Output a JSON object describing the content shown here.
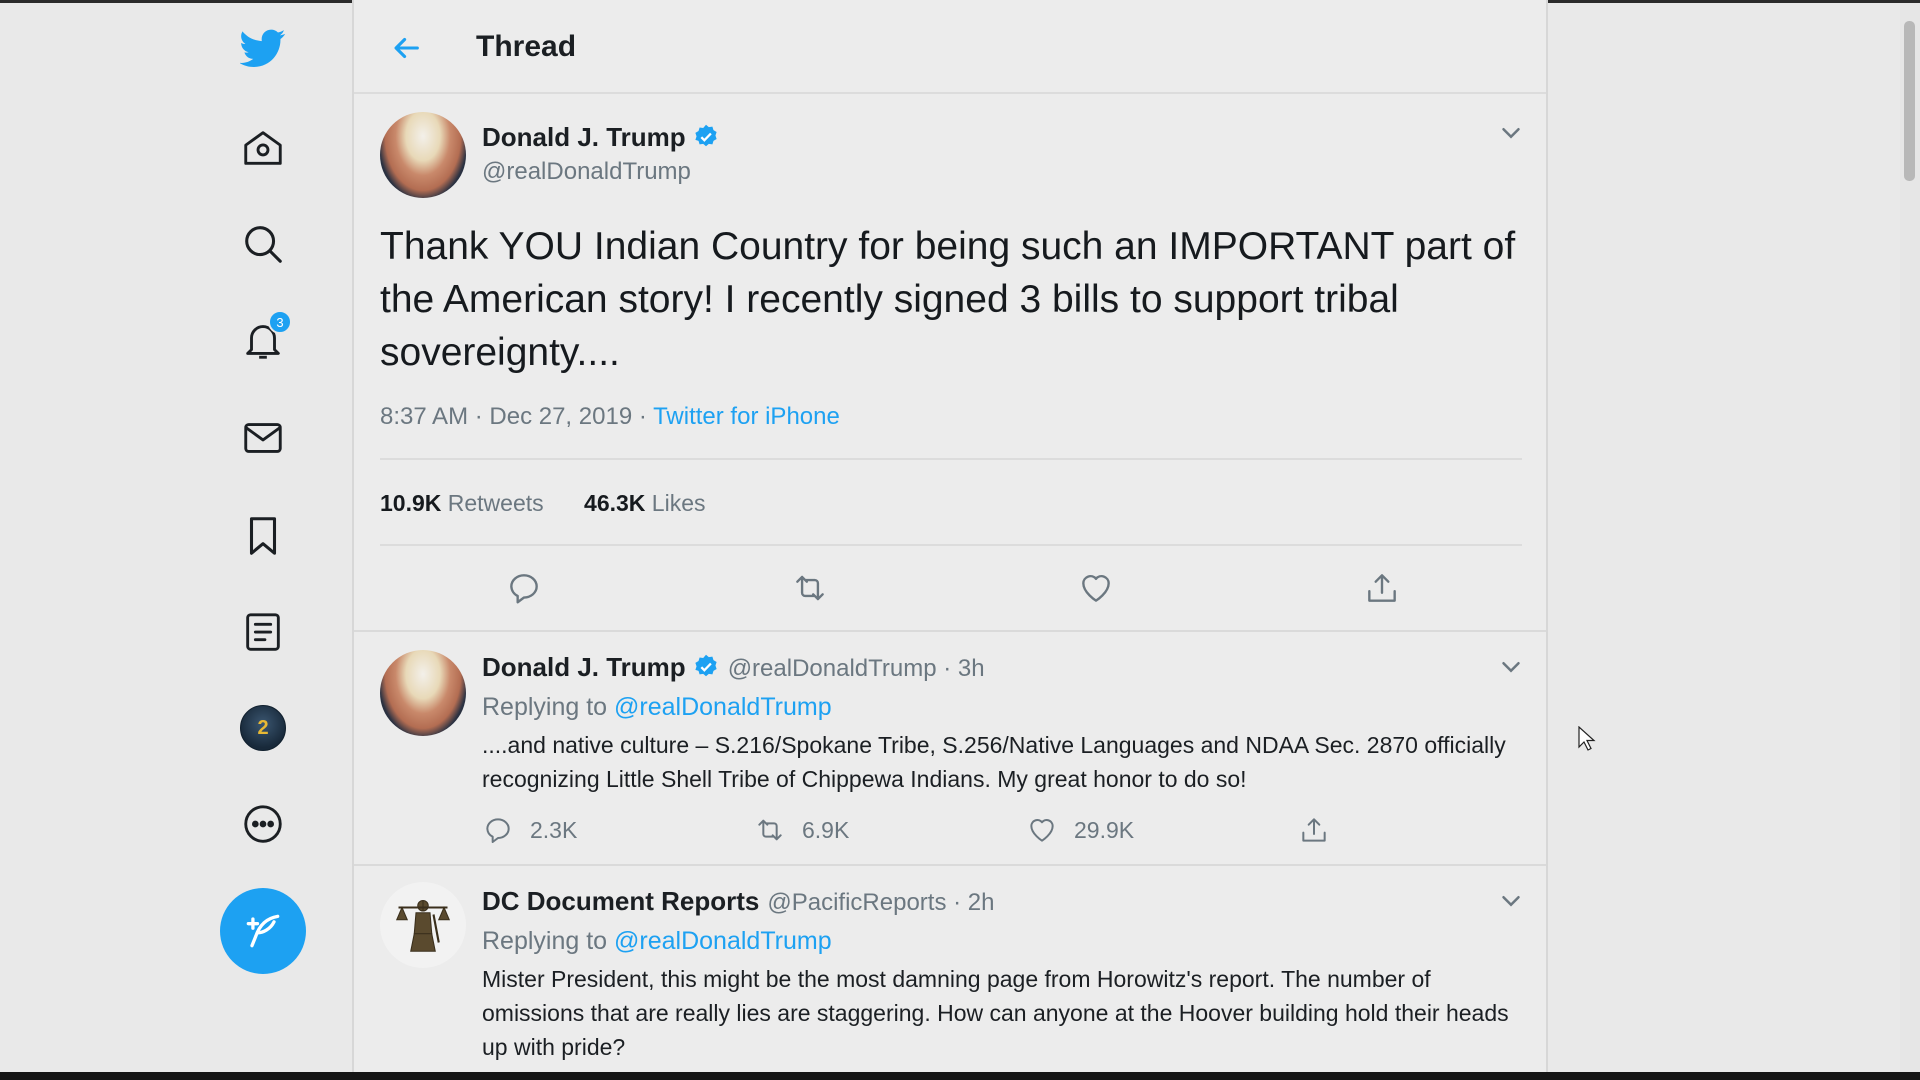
{
  "header": {
    "title": "Thread"
  },
  "sidebar": {
    "notification_count": "3",
    "profile_badge": "2"
  },
  "main_tweet": {
    "name": "Donald J. Trump",
    "handle": "@realDonaldTrump",
    "text": "Thank YOU Indian Country for being such an IMPORTANT part of the American story! I recently signed 3 bills to support tribal sovereignty....",
    "time": "8:37 AM",
    "date": "Dec 27, 2019",
    "source": "Twitter for iPhone",
    "retweets_count": "10.9K",
    "retweets_label": "Retweets",
    "likes_count": "46.3K",
    "likes_label": "Likes"
  },
  "replies": [
    {
      "name": "Donald J. Trump",
      "handle": "@realDonaldTrump · 3h",
      "replying_prefix": "Replying to",
      "replying_to": "@realDonaldTrump",
      "text": "....and native culture – S.216/Spokane Tribe, S.256/Native Languages and NDAA Sec. 2870 officially recognizing Little Shell Tribe of Chippewa Indians. My great honor to do so!",
      "reply_count": "2.3K",
      "retweet_count": "6.9K",
      "like_count": "29.9K"
    },
    {
      "name": "DC Document Reports",
      "handle": "@PacificReports · 2h",
      "replying_prefix": "Replying to",
      "replying_to": "@realDonaldTrump",
      "text": "Mister President, this might be the most damning page from Horowitz's report. The number of omissions that are really lies are staggering. How can anyone at the Hoover building hold their heads up with pride?"
    }
  ],
  "colors": {
    "accent": "#1da1f2",
    "background": "#ececec",
    "muted": "#6b7780"
  }
}
